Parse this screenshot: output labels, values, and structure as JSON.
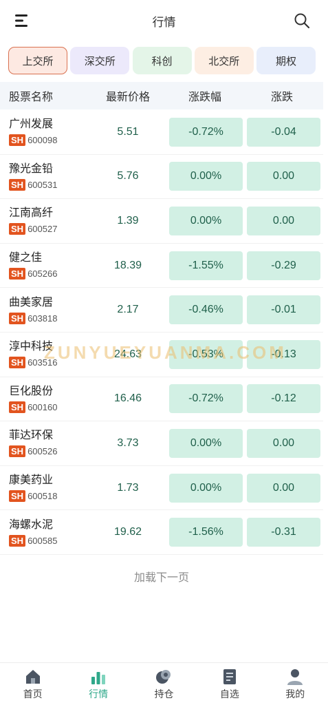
{
  "header": {
    "title": "行情"
  },
  "tabs": [
    {
      "label": "上交所",
      "active": true
    },
    {
      "label": "深交所",
      "active": false
    },
    {
      "label": "科创",
      "active": false
    },
    {
      "label": "北交所",
      "active": false
    },
    {
      "label": "期权",
      "active": false
    }
  ],
  "table": {
    "headers": {
      "name": "股票名称",
      "price": "最新价格",
      "pct": "涨跌幅",
      "chg": "涨跌"
    },
    "rows": [
      {
        "name": "广州发展",
        "market": "SH",
        "code": "600098",
        "price": "5.51",
        "pct": "-0.72%",
        "chg": "-0.04"
      },
      {
        "name": "豫光金铅",
        "market": "SH",
        "code": "600531",
        "price": "5.76",
        "pct": "0.00%",
        "chg": "0.00"
      },
      {
        "name": "江南高纤",
        "market": "SH",
        "code": "600527",
        "price": "1.39",
        "pct": "0.00%",
        "chg": "0.00"
      },
      {
        "name": "健之佳",
        "market": "SH",
        "code": "605266",
        "price": "18.39",
        "pct": "-1.55%",
        "chg": "-0.29"
      },
      {
        "name": "曲美家居",
        "market": "SH",
        "code": "603818",
        "price": "2.17",
        "pct": "-0.46%",
        "chg": "-0.01"
      },
      {
        "name": "淳中科技",
        "market": "SH",
        "code": "603516",
        "price": "24.63",
        "pct": "-0.53%",
        "chg": "-0.13"
      },
      {
        "name": "巨化股份",
        "market": "SH",
        "code": "600160",
        "price": "16.46",
        "pct": "-0.72%",
        "chg": "-0.12"
      },
      {
        "name": "菲达环保",
        "market": "SH",
        "code": "600526",
        "price": "3.73",
        "pct": "0.00%",
        "chg": "0.00"
      },
      {
        "name": "康美药业",
        "market": "SH",
        "code": "600518",
        "price": "1.73",
        "pct": "0.00%",
        "chg": "0.00"
      },
      {
        "name": "海螺水泥",
        "market": "SH",
        "code": "600585",
        "price": "19.62",
        "pct": "-1.56%",
        "chg": "-0.31"
      }
    ]
  },
  "load_more": "加载下一页",
  "watermark": "ZUNYUEYUANMA.COM",
  "bottom_nav": [
    {
      "label": "首页",
      "icon": "home-icon",
      "active": false
    },
    {
      "label": "行情",
      "icon": "market-chart-icon",
      "active": true
    },
    {
      "label": "持仓",
      "icon": "holdings-icon",
      "active": false
    },
    {
      "label": "自选",
      "icon": "watchlist-icon",
      "active": false
    },
    {
      "label": "我的",
      "icon": "user-icon",
      "active": false
    }
  ],
  "colors": {
    "accent": "#2fa88a",
    "pill_bg": "#d2f0e4",
    "badge": "#e2541f",
    "active_tab_border": "#d9704f"
  }
}
